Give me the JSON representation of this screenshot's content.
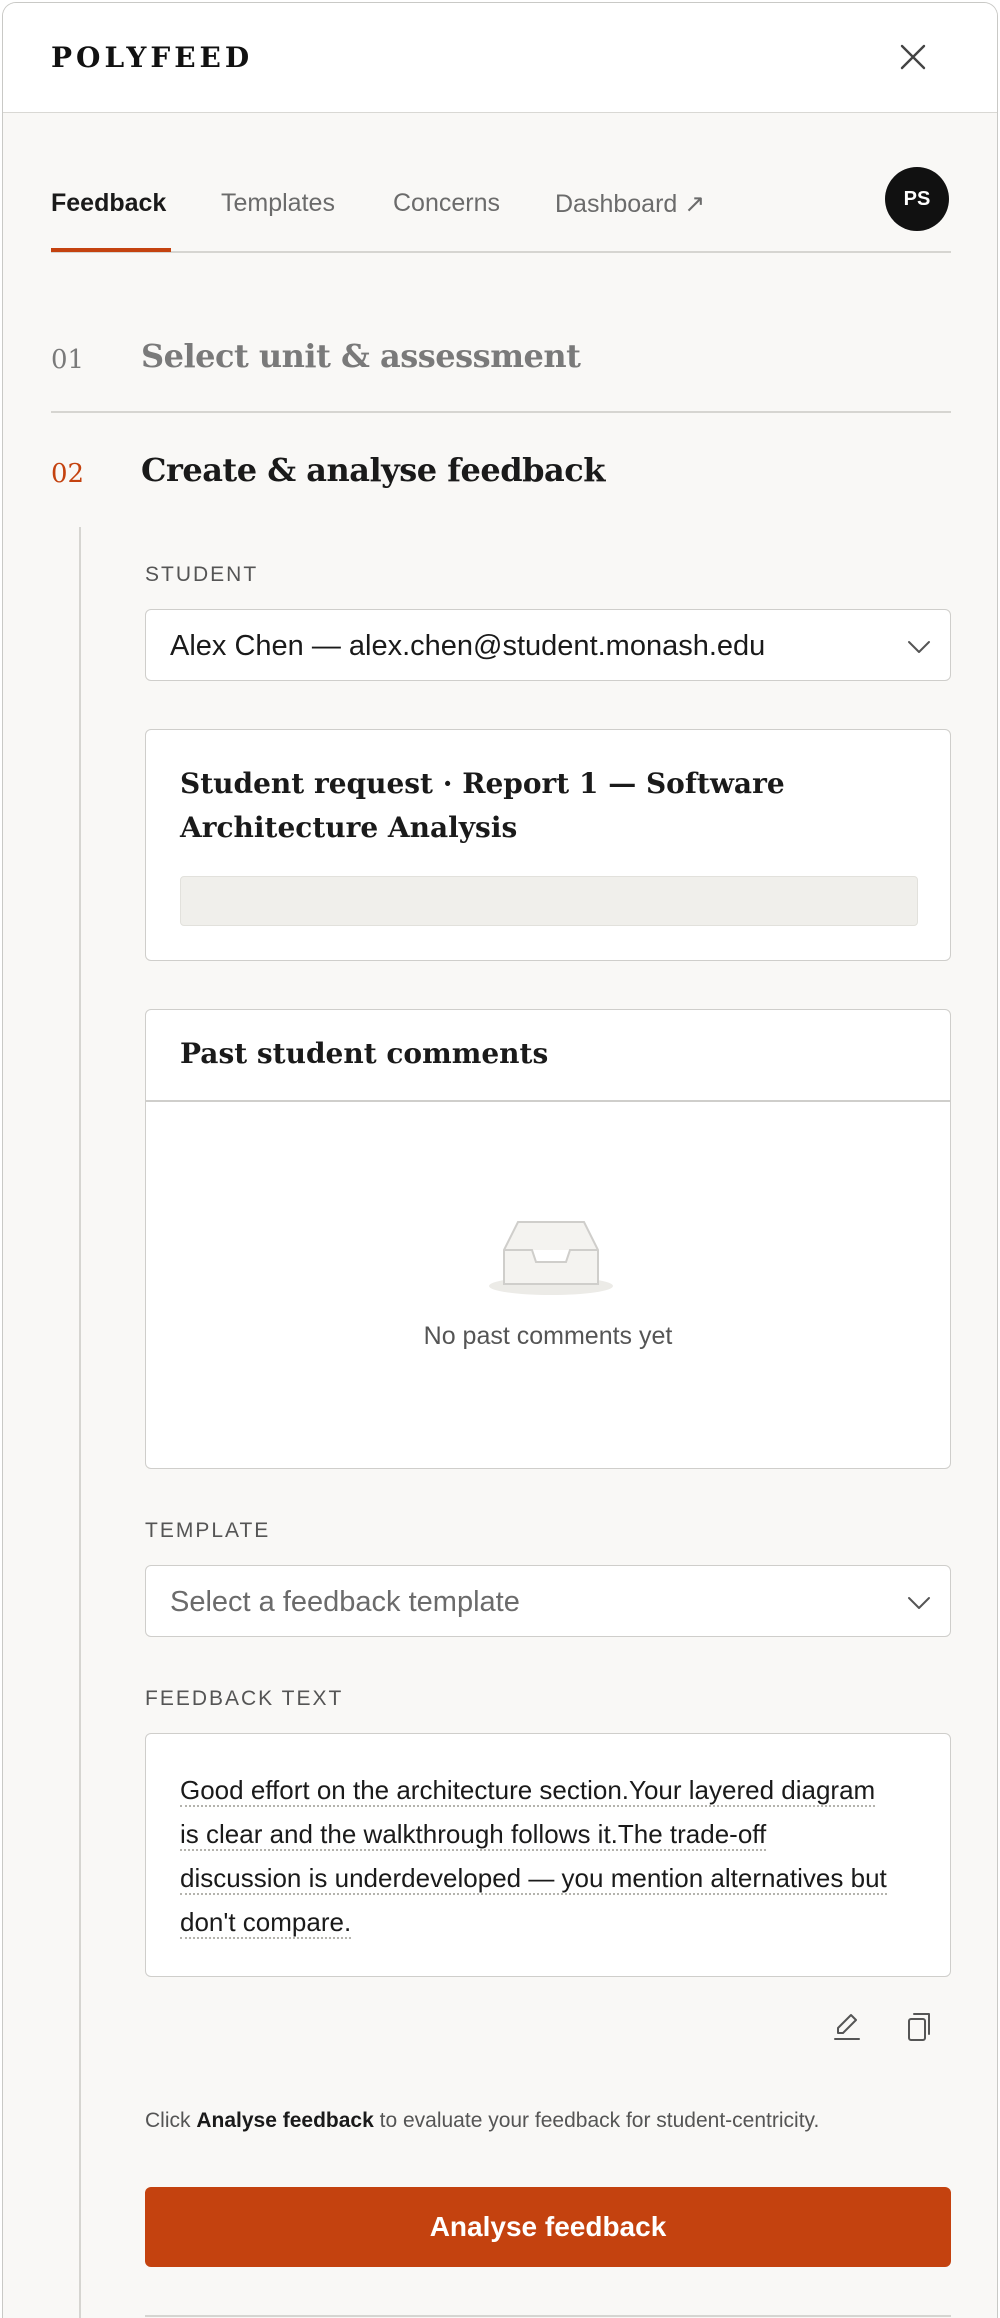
{
  "header": {
    "brand": "POLYFEED"
  },
  "tabs": [
    {
      "label": "Feedback",
      "active": true
    },
    {
      "label": "Templates"
    },
    {
      "label": "Concerns"
    },
    {
      "label": "Dashboard ↗"
    }
  ],
  "user": {
    "initials": "PS"
  },
  "steps": [
    {
      "number": "01",
      "title": "Select unit & assessment"
    },
    {
      "number": "02",
      "title": "Create & analyse feedback"
    }
  ],
  "student": {
    "label": "STUDENT",
    "selected": "Alex Chen — alex.chen@student.monash.edu"
  },
  "request_card": {
    "title": "Student request · Report 1 — Software Architecture Analysis"
  },
  "past_comments": {
    "title": "Past student comments",
    "empty_text": "No past comments yet"
  },
  "template": {
    "label": "TEMPLATE",
    "placeholder": "Select a feedback template"
  },
  "feedback": {
    "label": "FEEDBACK TEXT",
    "lines": [
      "Good effort on the architecture section.Your layered diagram",
      "is clear and the walkthrough follows it.The trade-off",
      "discussion is underdeveloped — you mention alternatives but",
      "don't compare."
    ]
  },
  "hint": {
    "prefix": "Click",
    "emphasis": "Analyse feedback",
    "suffix": "to evaluate your feedback for student-centricity."
  },
  "analyse_button": {
    "label": "Analyse feedback"
  },
  "colors": {
    "accent": "#c4420f",
    "background": "#f9f8f6"
  },
  "icons": [
    "close-icon",
    "chevron-down-icon",
    "inbox-icon",
    "edit-icon",
    "copy-icon"
  ]
}
